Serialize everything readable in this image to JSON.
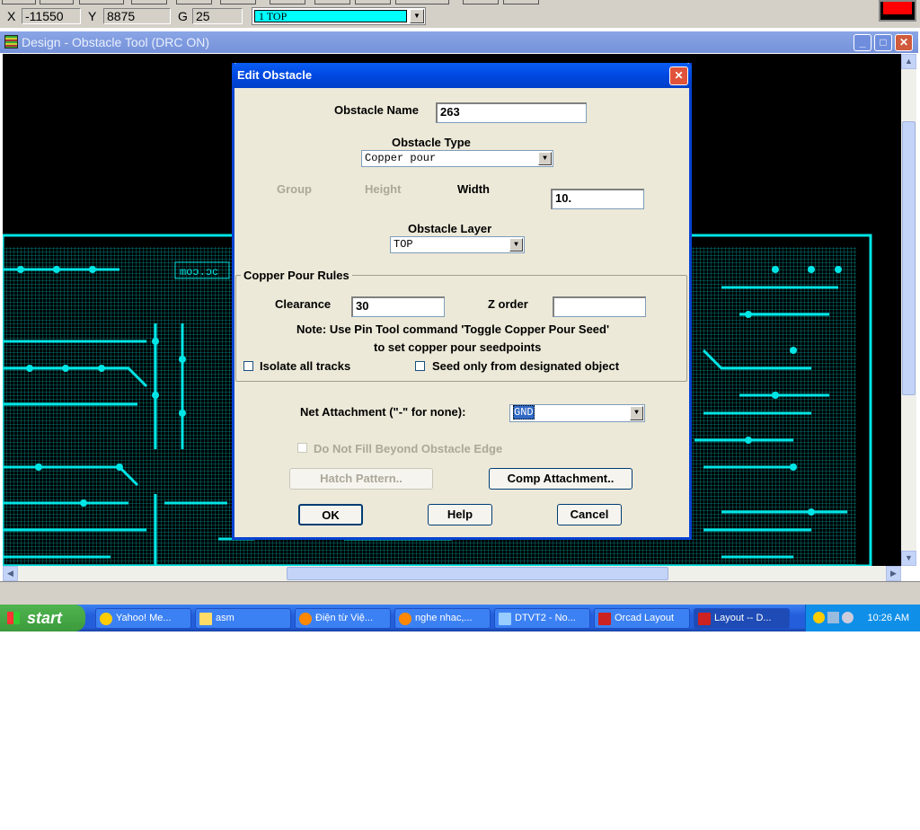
{
  "status": {
    "x_label": "X",
    "x": "-11550",
    "y_label": "Y",
    "y": "8875",
    "g_label": "G",
    "g": "25",
    "layer": "1 TOP"
  },
  "window": {
    "title": "Design - Obstacle Tool (DRC ON)",
    "minimize": "_",
    "maximize": "□",
    "close": "✕"
  },
  "pcb": {
    "silk_text": "moɔ.ɔc",
    "trace_color": "#00e5e5"
  },
  "dialog": {
    "title": "Edit Obstacle",
    "close": "✕",
    "obstacle_name_label": "Obstacle Name",
    "obstacle_name": "263",
    "obstacle_type_label": "Obstacle Type",
    "obstacle_type": "Copper pour",
    "group_label": "Group",
    "height_label": "Height",
    "width_label": "Width",
    "width": "10.",
    "obstacle_layer_label": "Obstacle Layer",
    "obstacle_layer": "TOP",
    "copper_rules": {
      "legend": "Copper Pour Rules",
      "clearance_label": "Clearance",
      "clearance": "30",
      "zorder_label": "Z order",
      "zorder": "",
      "note1": "Note: Use Pin Tool command 'Toggle Copper Pour Seed'",
      "note2": "to set copper pour seedpoints",
      "isolate_label": "Isolate all tracks",
      "seed_label": "Seed only from designated object"
    },
    "net_label": "Net Attachment (\"-\" for none):",
    "net": "GND",
    "no_fill_label": "Do Not Fill Beyond Obstacle Edge",
    "hatch_button": "Hatch Pattern..",
    "comp_button": "Comp Attachment..",
    "ok": "OK",
    "help": "Help",
    "cancel": "Cancel"
  },
  "taskbar": {
    "start": "start",
    "items": [
      "Yahoo! Me...",
      "asm",
      "Điện từ Việ...",
      "nghe nhac,...",
      "DTVT2 - No...",
      "Orcad Layout",
      "Layout -- D..."
    ],
    "clock": "10:26 AM"
  }
}
